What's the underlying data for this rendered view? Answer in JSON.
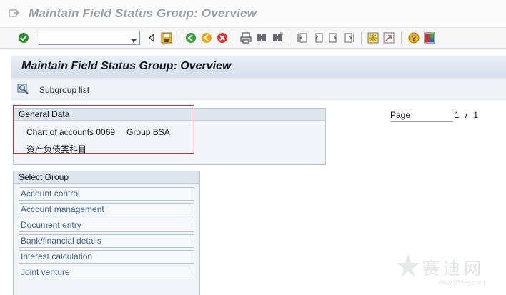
{
  "window": {
    "title": "Maintain Field Status Group: Overview"
  },
  "toolbar": {
    "command_field_value": "",
    "icons": [
      "enter-check-icon",
      "command-dropdown-icon",
      "collapse-triangle-icon",
      "save-icon",
      "back-icon",
      "exit-icon",
      "cancel-icon",
      "print-icon",
      "find-icon",
      "find-next-icon",
      "first-page-icon",
      "previous-page-icon",
      "next-page-icon",
      "last-page-icon",
      "create-session-icon",
      "shortcut-icon",
      "help-icon",
      "customize-layout-icon"
    ]
  },
  "screen": {
    "header_title": "Maintain Field Status Group: Overview",
    "subgroup_button_label": "Subgroup list"
  },
  "general_data": {
    "title": "General Data",
    "chart_of_accounts_text": "Chart of accounts 0069",
    "group_text": "Group BSA",
    "description": "资产负债类科目"
  },
  "paging": {
    "label": "Page",
    "current": "1",
    "separator": "/",
    "total": "1"
  },
  "select_group": {
    "title": "Select Group",
    "items": [
      {
        "label": "Account control"
      },
      {
        "label": "Account management"
      },
      {
        "label": "Document entry"
      },
      {
        "label": "Bank/financial details"
      },
      {
        "label": "Interest calculation"
      },
      {
        "label": "Joint venture"
      }
    ]
  },
  "watermark": {
    "text": "赛迪网",
    "url": "www.91sap.com"
  },
  "colors": {
    "highlight_frame": "#d62a2a",
    "link_text": "#3b63a6",
    "header_bg": "#d3dfeb"
  }
}
